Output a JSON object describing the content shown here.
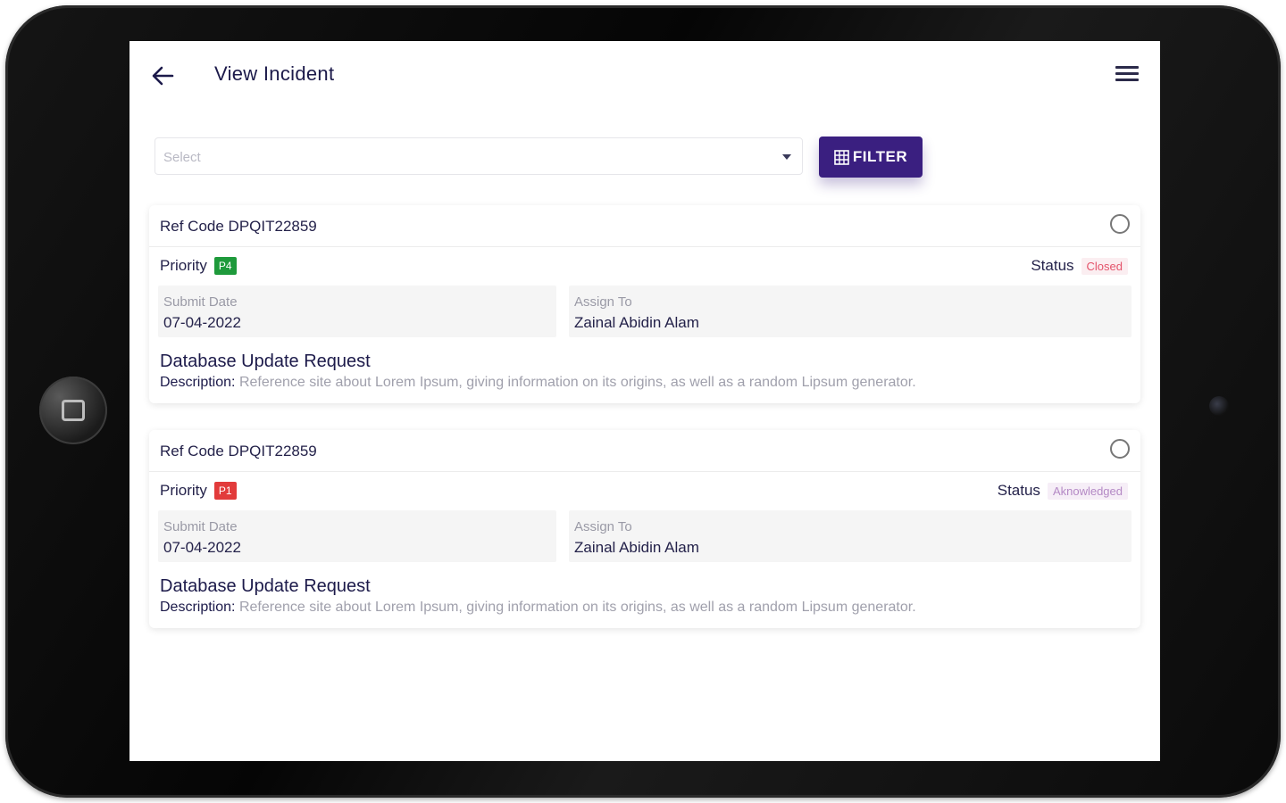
{
  "header": {
    "title": "View Incident"
  },
  "filter": {
    "placeholder": "Select",
    "button_label": "FILTER"
  },
  "colors": {
    "accent": "#3a1f80",
    "priority_p4": "#1e9a3b",
    "priority_p1": "#e23b3b",
    "status_closed": "#e4536b",
    "status_acknowledged": "#b489c5"
  },
  "incidents": [
    {
      "ref_label": "Ref Code DPQIT22859",
      "priority_label": "Priority",
      "priority": "P4",
      "status_label": "Status",
      "status": "Closed",
      "submit_date_label": "Submit Date",
      "submit_date": "07-04-2022",
      "assign_to_label": "Assign To",
      "assign_to": "Zainal Abidin Alam",
      "title": "Database Update Request",
      "description_label": "Description:",
      "description": "Reference site about Lorem Ipsum, giving information on its origins, as well as a random Lipsum generator."
    },
    {
      "ref_label": "Ref Code DPQIT22859",
      "priority_label": "Priority",
      "priority": "P1",
      "status_label": "Status",
      "status": "Aknowledged",
      "submit_date_label": "Submit Date",
      "submit_date": "07-04-2022",
      "assign_to_label": "Assign To",
      "assign_to": "Zainal Abidin Alam",
      "title": "Database Update Request",
      "description_label": "Description:",
      "description": "Reference site about Lorem Ipsum, giving information on its origins, as well as a random Lipsum generator."
    }
  ]
}
